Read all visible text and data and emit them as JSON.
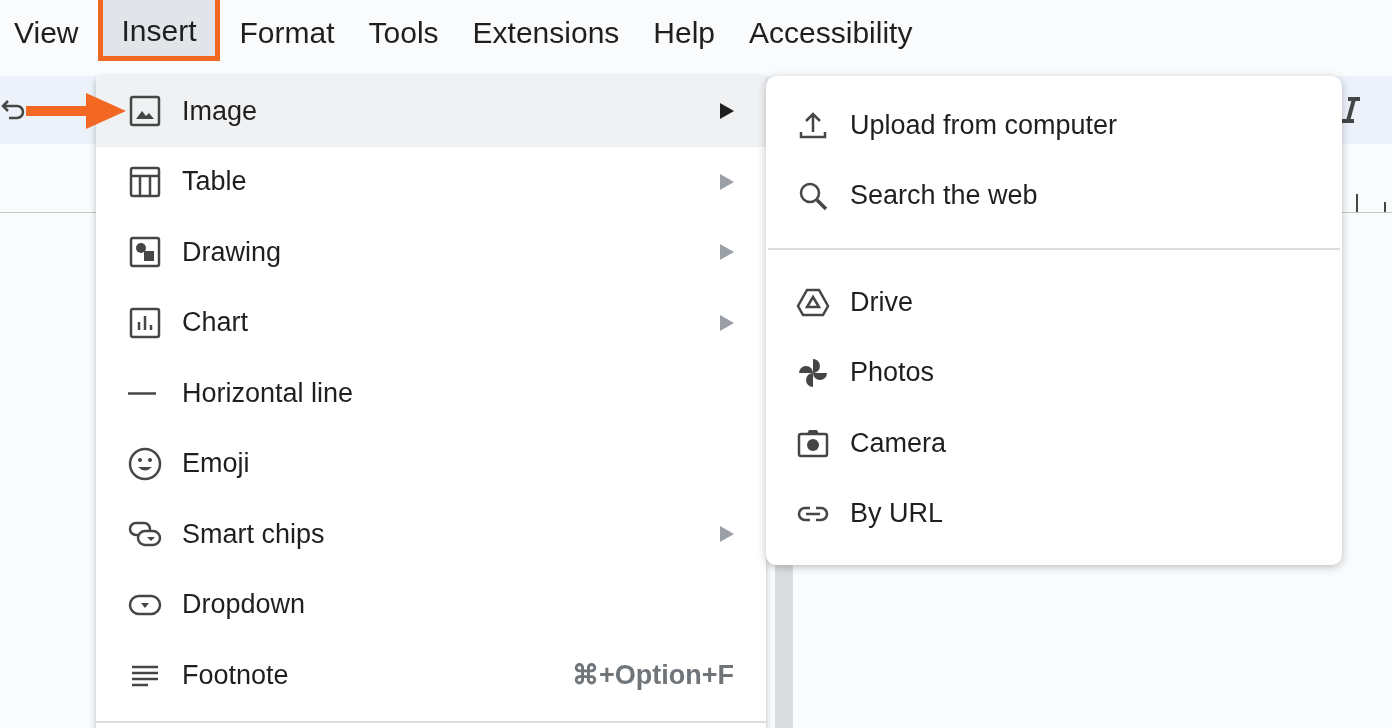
{
  "menubar": [
    {
      "label": "View",
      "selected": false,
      "highlighted": false
    },
    {
      "label": "Insert",
      "selected": true,
      "highlighted": true
    },
    {
      "label": "Format",
      "selected": false,
      "highlighted": false
    },
    {
      "label": "Tools",
      "selected": false,
      "highlighted": false
    },
    {
      "label": "Extensions",
      "selected": false,
      "highlighted": false
    },
    {
      "label": "Help",
      "selected": false,
      "highlighted": false
    },
    {
      "label": "Accessibility",
      "selected": false,
      "highlighted": false
    }
  ],
  "insert_menu": [
    {
      "label": "Image",
      "selected": true,
      "submenu": true
    },
    {
      "label": "Table",
      "selected": false,
      "submenu": true
    },
    {
      "label": "Drawing",
      "selected": false,
      "submenu": true
    },
    {
      "label": "Chart",
      "selected": false,
      "submenu": true
    },
    {
      "label": "Horizontal line",
      "selected": false,
      "submenu": false
    },
    {
      "label": "Emoji",
      "selected": false,
      "submenu": false
    },
    {
      "label": "Smart chips",
      "selected": false,
      "submenu": true
    },
    {
      "label": "Dropdown",
      "selected": false,
      "submenu": false
    },
    {
      "label": "Footnote",
      "selected": false,
      "submenu": false,
      "shortcut": "⌘+Option+F"
    }
  ],
  "image_submenu": [
    [
      {
        "label": "Upload from computer"
      },
      {
        "label": "Search the web"
      }
    ],
    [
      {
        "label": "Drive"
      },
      {
        "label": "Photos"
      },
      {
        "label": "Camera"
      },
      {
        "label": "By URL"
      }
    ]
  ]
}
